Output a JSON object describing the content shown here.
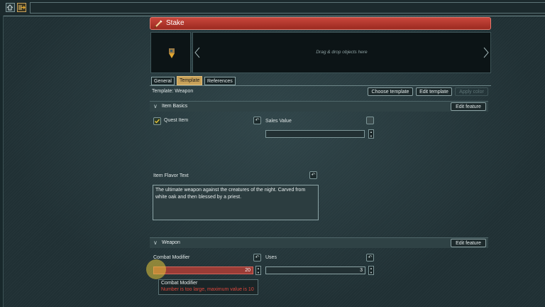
{
  "item": {
    "title": "Stake"
  },
  "dropzone": {
    "hint": "Drag & drop objects here"
  },
  "tabs": [
    {
      "label": "General",
      "active": false
    },
    {
      "label": "Template",
      "active": true
    },
    {
      "label": "References",
      "active": false
    }
  ],
  "template": {
    "label": "Template: Weapon",
    "choose_button": "Choose template",
    "edit_button": "Edit template",
    "apply_color_button": "Apply color"
  },
  "sections": {
    "item_basics": {
      "title": "Item Basics",
      "edit_button": "Edit feature"
    },
    "weapon": {
      "title": "Weapon",
      "edit_button": "Edit feature"
    }
  },
  "fields": {
    "quest_item": {
      "label": "Quest Item",
      "checked": true
    },
    "sales_value": {
      "label": "Sales Value",
      "value": ""
    },
    "flavor_text": {
      "label": "Item Flavor Text",
      "value": "The ultimate weapon against the creatures of the night. Carved from white oak and then blessed by a priest."
    },
    "combat_modifier": {
      "label": "Combat Modifier",
      "value": "20"
    },
    "uses": {
      "label": "Uses",
      "value": "3"
    }
  },
  "tooltip": {
    "title": "Combat Modifier",
    "error": "Number is too large, maximum value is 10"
  },
  "colors": {
    "title_bar": "#b3362d",
    "active_tab": "#c9a25a",
    "error_field": "#9a3c36",
    "error_text": "#e0463c"
  },
  "icons": {
    "toolbar_1": "home-arrow-icon",
    "toolbar_2": "export-icon",
    "title": "sword-icon",
    "thumbnail": "stake-icon"
  }
}
